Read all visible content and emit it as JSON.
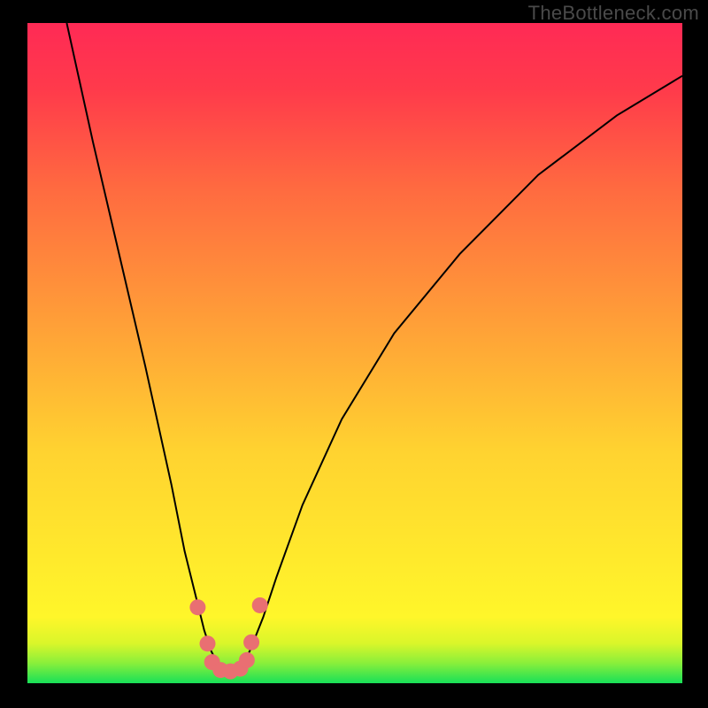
{
  "watermark": "TheBottleneck.com",
  "chart_data": {
    "type": "line",
    "title": "",
    "xlabel": "",
    "ylabel": "",
    "xlim": [
      0,
      100
    ],
    "ylim": [
      0,
      100
    ],
    "grid": false,
    "gradient_stops": [
      {
        "offset": 0,
        "color": "#18e058"
      },
      {
        "offset": 3,
        "color": "#88ef3b"
      },
      {
        "offset": 6,
        "color": "#d9f62a"
      },
      {
        "offset": 10,
        "color": "#fff62a"
      },
      {
        "offset": 35,
        "color": "#ffd330"
      },
      {
        "offset": 55,
        "color": "#ff9e38"
      },
      {
        "offset": 75,
        "color": "#ff6a40"
      },
      {
        "offset": 90,
        "color": "#ff3a4b"
      },
      {
        "offset": 100,
        "color": "#ff2a55"
      }
    ],
    "series": [
      {
        "name": "bottleneck-curve",
        "color": "#000000",
        "x": [
          6,
          10,
          14,
          18,
          22,
          24,
          26,
          27,
          28,
          29,
          30,
          31,
          32,
          33,
          34,
          36,
          38,
          42,
          48,
          56,
          66,
          78,
          90,
          100
        ],
        "values": [
          100,
          82,
          65,
          48,
          30,
          20,
          12,
          8,
          5,
          3,
          2,
          2,
          2,
          3,
          5,
          10,
          16,
          27,
          40,
          53,
          65,
          77,
          86,
          92
        ]
      }
    ],
    "markers": {
      "name": "highlight-dots",
      "color": "#e96f72",
      "radius": 9,
      "points": [
        {
          "x": 26.0,
          "y": 11.5
        },
        {
          "x": 27.5,
          "y": 6.0
        },
        {
          "x": 28.2,
          "y": 3.2
        },
        {
          "x": 29.5,
          "y": 2.0
        },
        {
          "x": 31.0,
          "y": 1.8
        },
        {
          "x": 32.5,
          "y": 2.2
        },
        {
          "x": 33.5,
          "y": 3.5
        },
        {
          "x": 34.2,
          "y": 6.2
        },
        {
          "x": 35.5,
          "y": 11.8
        }
      ]
    }
  }
}
